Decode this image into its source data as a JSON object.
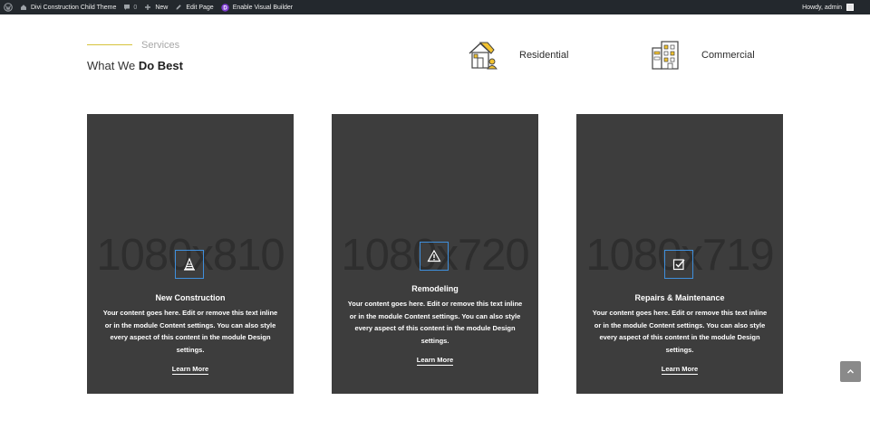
{
  "admin_bar": {
    "site_name": "Divi Construction Child Theme",
    "comments_count": "0",
    "new_label": "New",
    "edit_page_label": "Edit Page",
    "visual_builder_label": "Enable Visual Builder",
    "greeting": "Howdy, admin"
  },
  "header": {
    "label": "Services",
    "title_prefix": "What We ",
    "title_bold": "Do Best",
    "features": [
      {
        "label": "Residential",
        "icon": "house-icon"
      },
      {
        "label": "Commercial",
        "icon": "building-icon"
      }
    ]
  },
  "cards": [
    {
      "placeholder": "1080x810",
      "icon": "traffic-cone-icon",
      "title": "New Construction",
      "body": "Your content goes here. Edit or remove this text inline or in the module Content settings. You can also style every aspect of this content in the module Design settings.",
      "link": "Learn More"
    },
    {
      "placeholder": "1080x720",
      "icon": "warning-icon",
      "title": "Remodeling",
      "body": "Your content goes here. Edit or remove this text inline or in the module Content settings. You can also style every aspect of this content in the module Design settings.",
      "link": "Learn More"
    },
    {
      "placeholder": "1080x719",
      "icon": "checkbox-icon",
      "title": "Repairs & Maintenance",
      "body": "Your content goes here. Edit or remove this text inline or in the module Content settings. You can also style every aspect of this content in the module Design settings.",
      "link": "Learn More"
    }
  ],
  "colors": {
    "admin_bar": "#23282d",
    "card_background": "#3d3d3d",
    "accent_line": "#d6c33b",
    "icon_border": "#3f8fdc"
  }
}
